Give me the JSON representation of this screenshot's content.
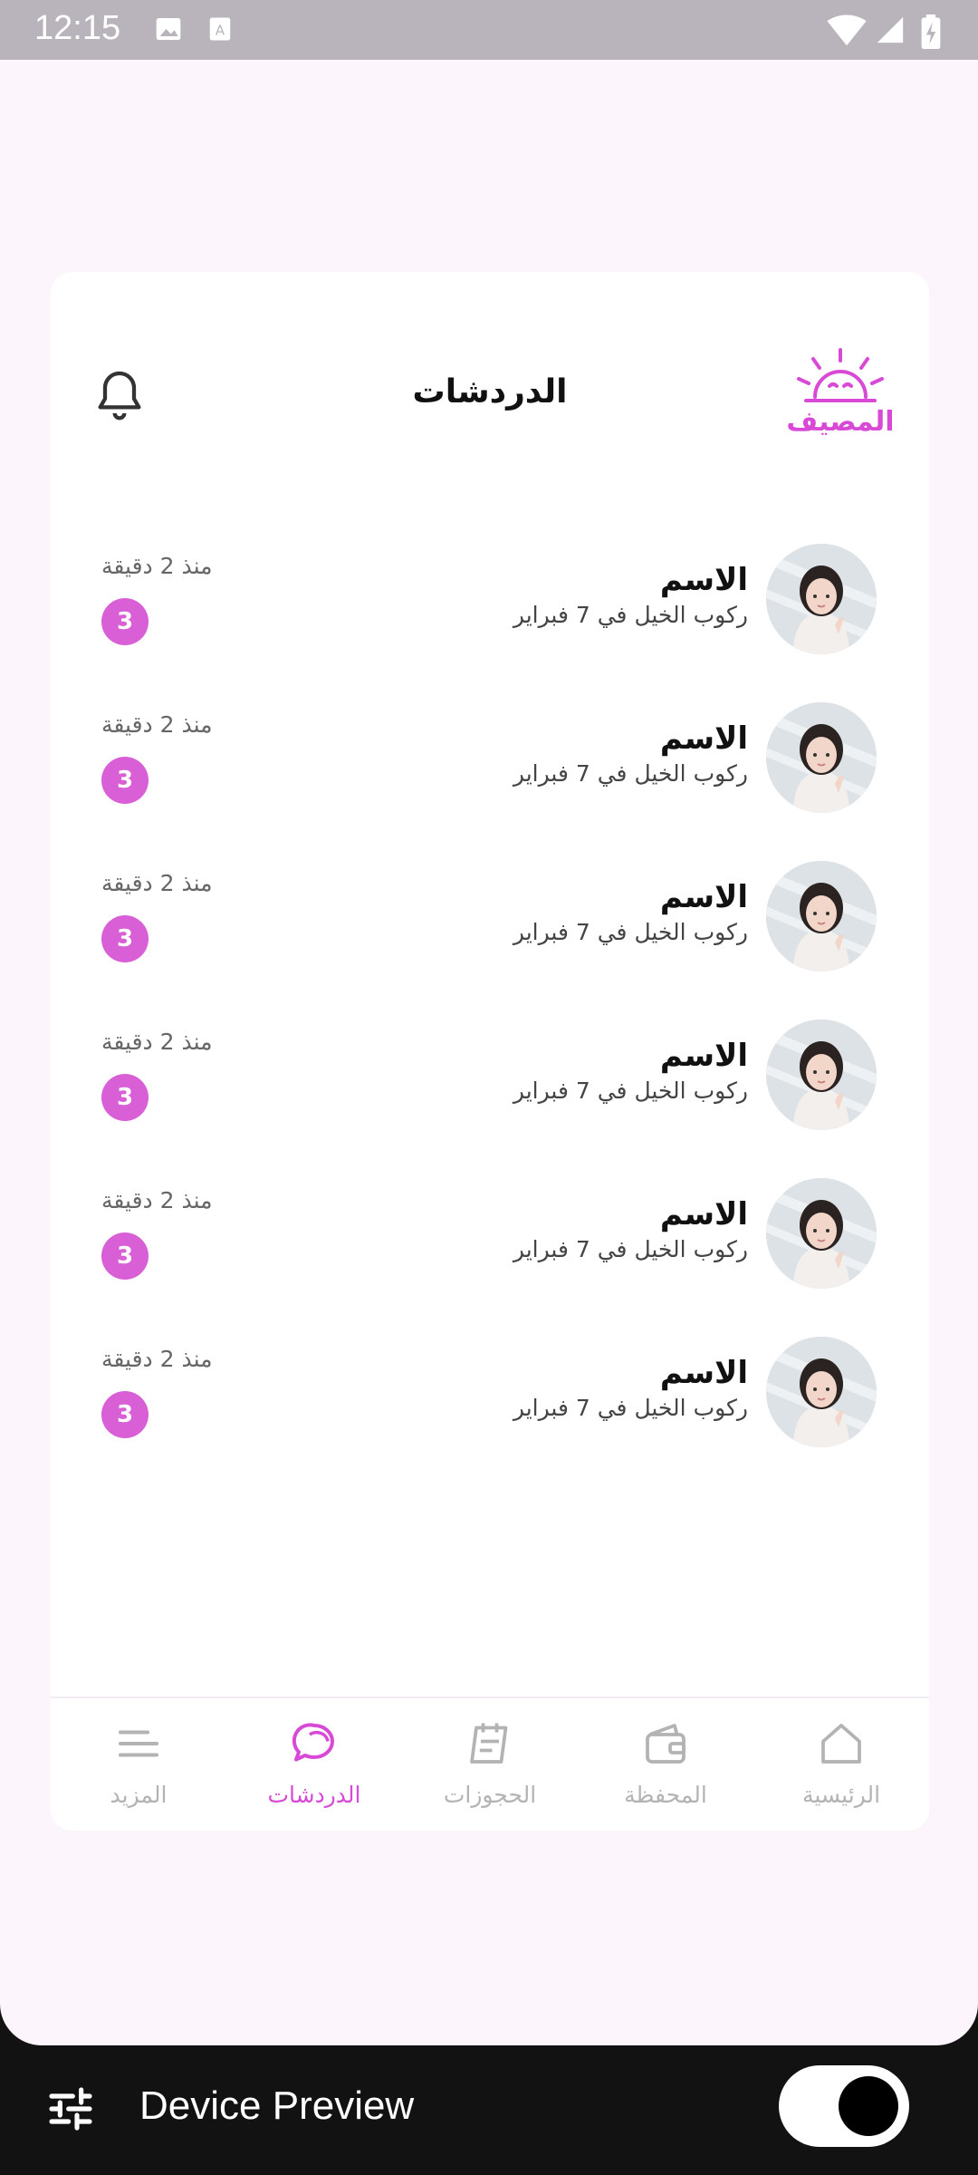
{
  "status_bar": {
    "time": "12:15"
  },
  "header": {
    "title": "الدردشات",
    "logo_text": "المصيف"
  },
  "chats": [
    {
      "name": "الاسم",
      "preview": "ركوب الخيل في 7 فبراير",
      "time": "منذ 2 دقيقة",
      "unread": "3"
    },
    {
      "name": "الاسم",
      "preview": "ركوب الخيل في 7 فبراير",
      "time": "منذ 2 دقيقة",
      "unread": "3"
    },
    {
      "name": "الاسم",
      "preview": "ركوب الخيل في 7 فبراير",
      "time": "منذ 2 دقيقة",
      "unread": "3"
    },
    {
      "name": "الاسم",
      "preview": "ركوب الخيل في 7 فبراير",
      "time": "منذ 2 دقيقة",
      "unread": "3"
    },
    {
      "name": "الاسم",
      "preview": "ركوب الخيل في 7 فبراير",
      "time": "منذ 2 دقيقة",
      "unread": "3"
    },
    {
      "name": "الاسم",
      "preview": "ركوب الخيل في 7 فبراير",
      "time": "منذ 2 دقيقة",
      "unread": "3"
    }
  ],
  "bottom_nav": {
    "items": [
      {
        "label": "المزيد",
        "icon": "menu-icon",
        "active": false
      },
      {
        "label": "الدردشات",
        "icon": "chat-icon",
        "active": true
      },
      {
        "label": "الحجوزات",
        "icon": "bookings-icon",
        "active": false
      },
      {
        "label": "المحفظة",
        "icon": "wallet-icon",
        "active": false
      },
      {
        "label": "الرئيسية",
        "icon": "home-icon",
        "active": false
      }
    ]
  },
  "device_preview": {
    "label": "Device Preview",
    "toggle_on": true
  },
  "colors": {
    "accent": "#d84ad6",
    "badge": "#d95fd7",
    "inactive": "#b3b3b3",
    "screen_bg": "#fcf5fc"
  }
}
